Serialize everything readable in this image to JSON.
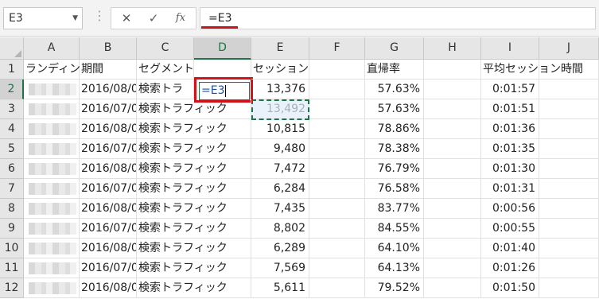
{
  "formula_bar": {
    "name_box": "E3",
    "cancel_icon": "✕",
    "enter_icon": "✓",
    "fx_label": "fx",
    "formula": "=E3"
  },
  "columns": [
    "A",
    "B",
    "C",
    "D",
    "E",
    "F",
    "G",
    "H",
    "I",
    "J"
  ],
  "headers": {
    "A": "ランディン",
    "B": "期間",
    "C": "セグメント",
    "E": "セッション",
    "G": "直帰率",
    "I": "平均セッション時間"
  },
  "rows": [
    {
      "num": "2",
      "period": "2016/08/0",
      "segment": "検索トラ",
      "sessions": "13,376",
      "bounce": "57.63%",
      "avg": "0:01:57"
    },
    {
      "num": "3",
      "period": "2016/07/0",
      "segment": "検索トラフィック",
      "sessions": "13,492",
      "bounce": "57.63%",
      "avg": "0:01:51"
    },
    {
      "num": "4",
      "period": "2016/08/0",
      "segment": "検索トラフィック",
      "sessions": "10,815",
      "bounce": "78.86%",
      "avg": "0:01:36"
    },
    {
      "num": "5",
      "period": "2016/07/0",
      "segment": "検索トラフィック",
      "sessions": "9,480",
      "bounce": "78.38%",
      "avg": "0:01:35"
    },
    {
      "num": "6",
      "period": "2016/08/0",
      "segment": "検索トラフィック",
      "sessions": "7,472",
      "bounce": "76.79%",
      "avg": "0:01:30"
    },
    {
      "num": "7",
      "period": "2016/07/0",
      "segment": "検索トラフィック",
      "sessions": "6,284",
      "bounce": "76.58%",
      "avg": "0:01:31"
    },
    {
      "num": "8",
      "period": "2016/08/0",
      "segment": "検索トラフィック",
      "sessions": "7,435",
      "bounce": "83.77%",
      "avg": "0:00:56"
    },
    {
      "num": "9",
      "period": "2016/07/0",
      "segment": "検索トラフィック",
      "sessions": "8,802",
      "bounce": "84.55%",
      "avg": "0:00:55"
    },
    {
      "num": "10",
      "period": "2016/08/0",
      "segment": "検索トラフィック",
      "sessions": "6,289",
      "bounce": "64.10%",
      "avg": "0:01:40"
    },
    {
      "num": "11",
      "period": "2016/07/0",
      "segment": "検索トラフィック",
      "sessions": "7,569",
      "bounce": "64.13%",
      "avg": "0:01:26"
    },
    {
      "num": "12",
      "period": "2016/08/0",
      "segment": "検索トラフィック",
      "sessions": "5,611",
      "bounce": "79.52%",
      "avg": "0:01:50"
    }
  ],
  "editing_cell": {
    "address": "D2",
    "text": "=E3"
  },
  "accent_colors": {
    "excel_green": "#217346",
    "highlight_red": "#d3111a"
  }
}
